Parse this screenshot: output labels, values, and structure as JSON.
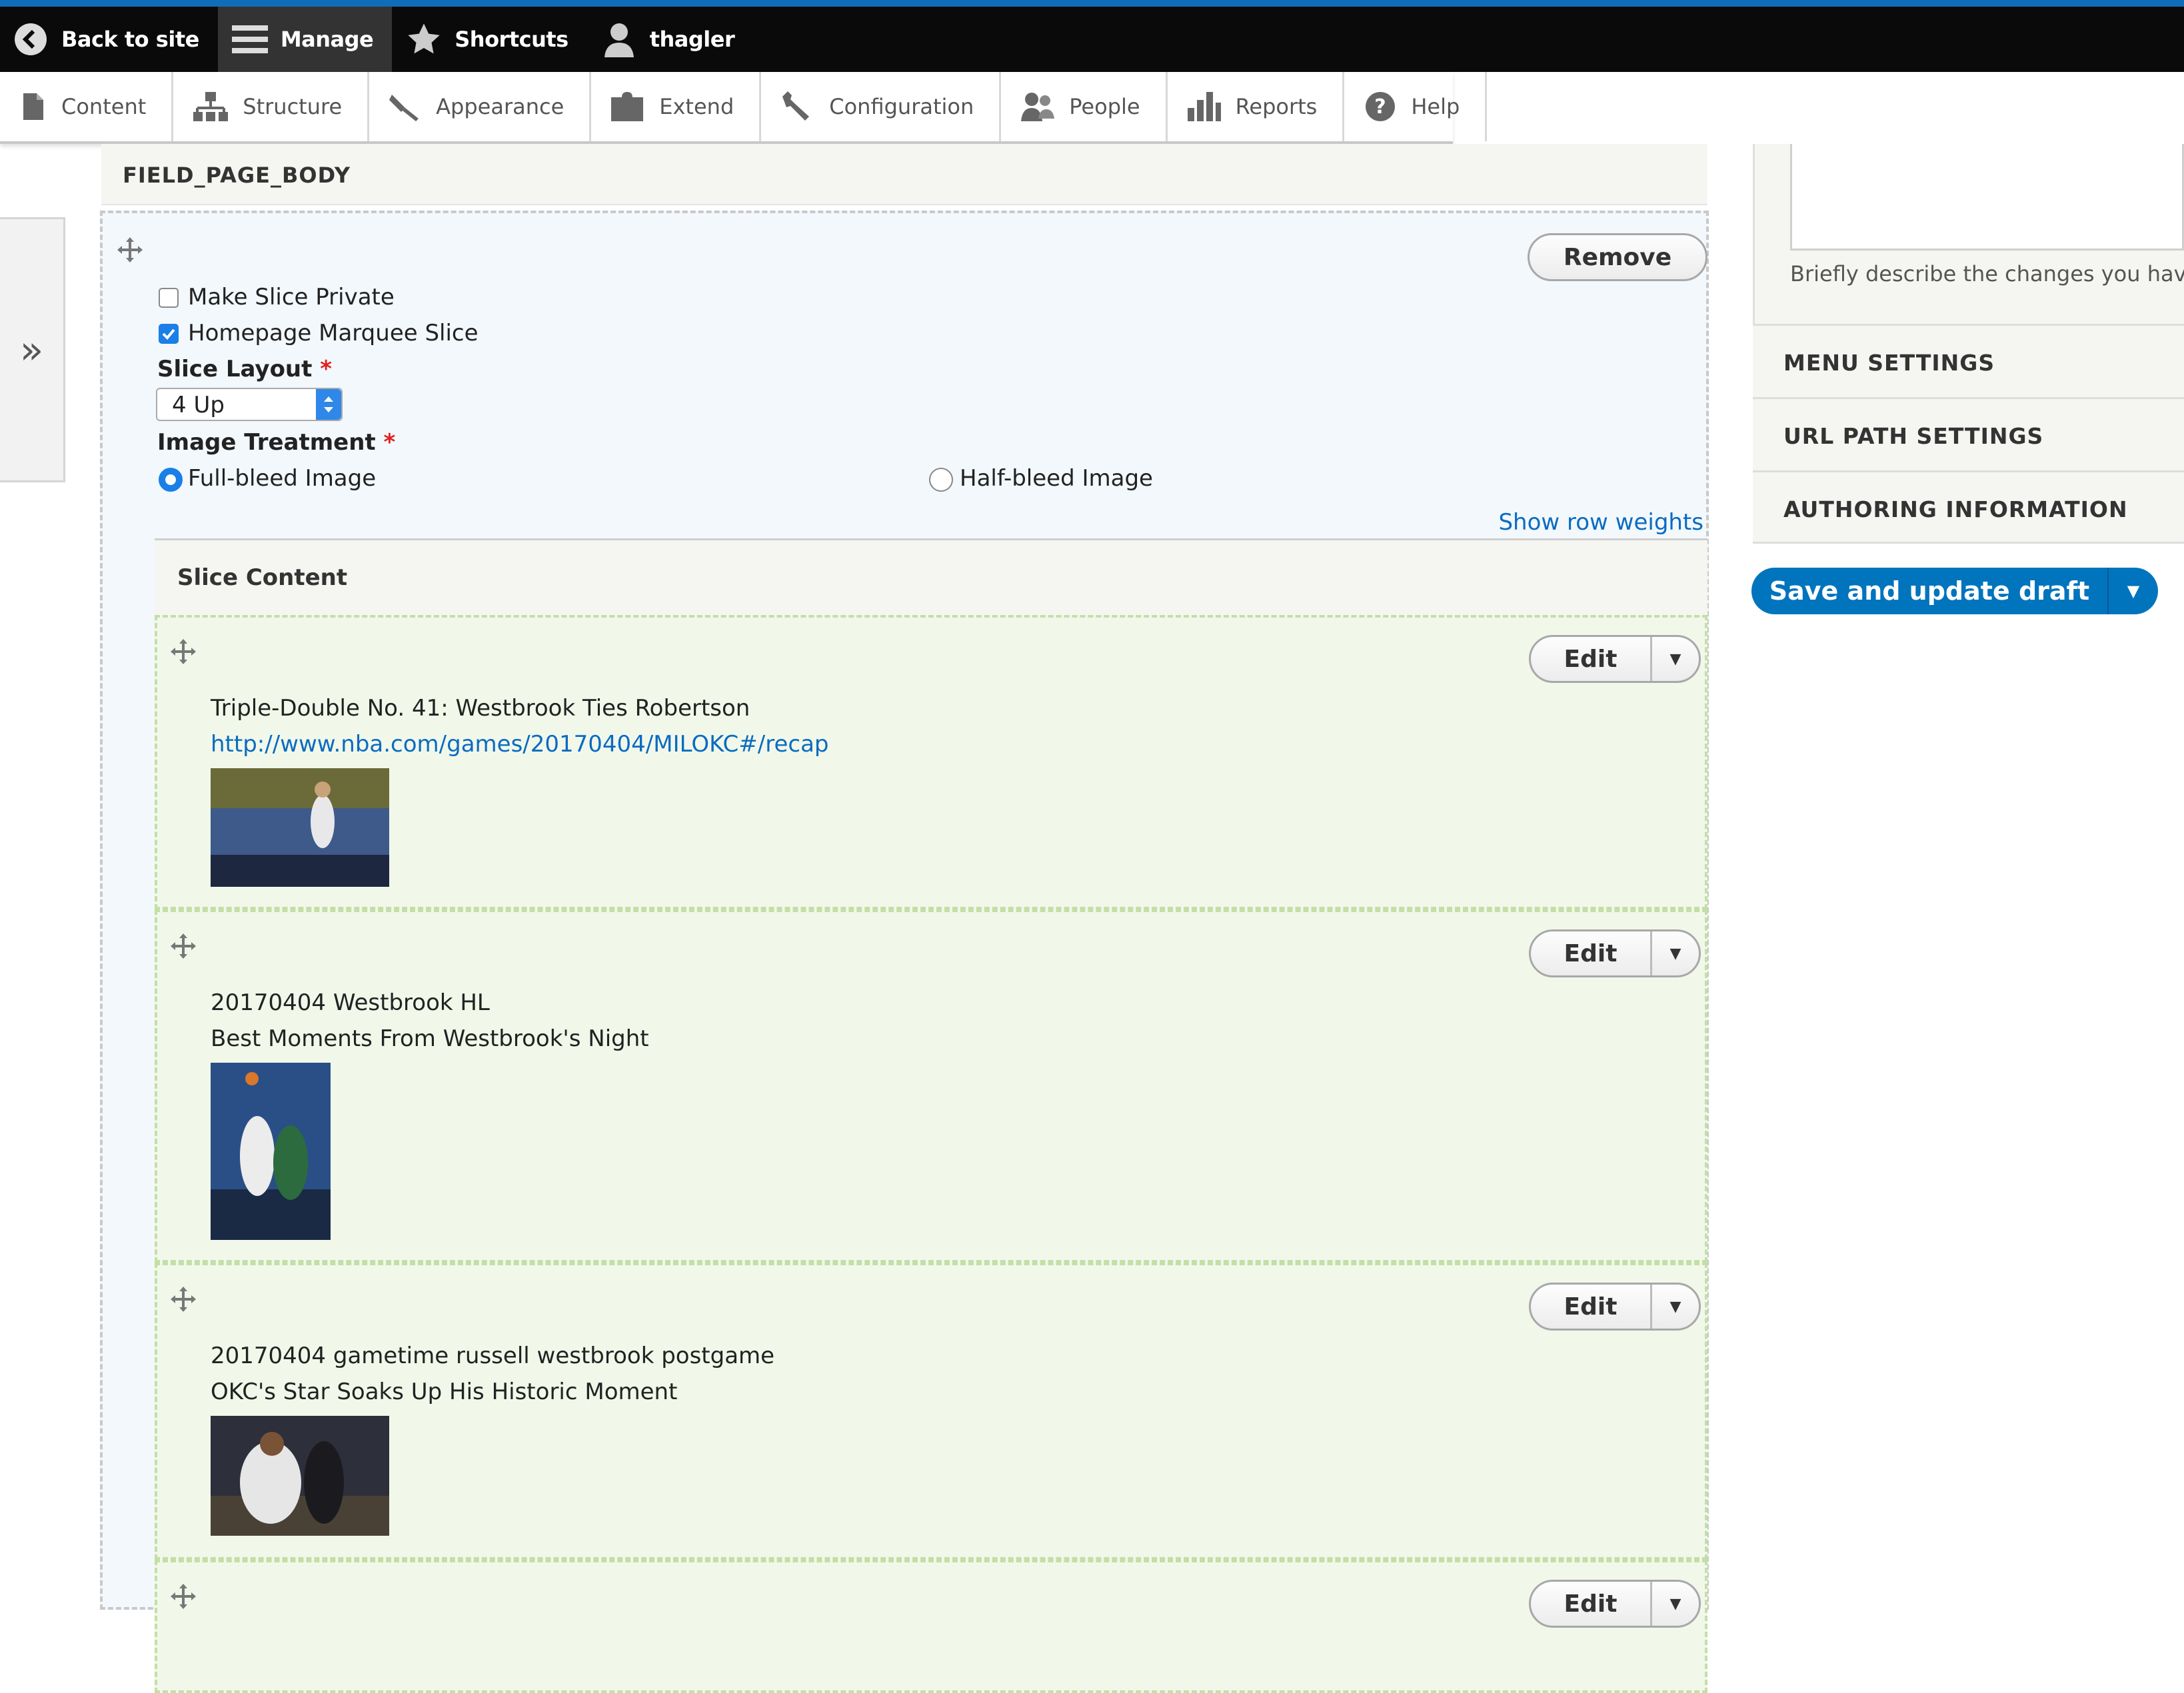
{
  "toolbar": {
    "back": "Back to site",
    "manage": "Manage",
    "shortcuts": "Shortcuts",
    "user": "thagler"
  },
  "tray": {
    "content": "Content",
    "structure": "Structure",
    "appearance": "Appearance",
    "extend": "Extend",
    "configuration": "Configuration",
    "people": "People",
    "reports": "Reports",
    "help": "Help"
  },
  "sidebar_toggle": "»",
  "field": {
    "header": "FIELD_PAGE_BODY",
    "remove_label": "Remove",
    "make_private_label": "Make Slice Private",
    "make_private_checked": false,
    "marquee_label": "Homepage Marquee Slice",
    "marquee_checked": true,
    "layout_label": "Slice Layout",
    "layout_value": "4 Up",
    "treatment_label": "Image Treatment",
    "required_mark": "*",
    "full_bleed_label": "Full-bleed Image",
    "half_bleed_label": "Half-bleed Image",
    "selected_treatment": "Full-bleed Image",
    "show_weights": "Show row weights"
  },
  "slice_content": {
    "header": "Slice Content",
    "edit_label": "Edit",
    "items": [
      {
        "title": "Triple-Double No. 41: Westbrook Ties Robertson",
        "subtitle": "http://www.nba.com/games/20170404/MILOKC#/recap"
      },
      {
        "title": "20170404 Westbrook HL",
        "subtitle": "Best Moments From Westbrook's Night"
      },
      {
        "title": "20170404 gametime russell westbrook postgame",
        "subtitle": "OKC's Star Soaks Up His Historic Moment"
      }
    ]
  },
  "right": {
    "revision_desc": "Briefly describe the changes you have",
    "menu_settings": "MENU SETTINGS",
    "url_settings": "URL PATH SETTINGS",
    "authoring": "AUTHORING INFORMATION",
    "save_label": "Save and update draft"
  },
  "colors": {
    "accent": "#0074bd",
    "toolbar": "#0a0a0a",
    "item_bg": "#f1f8ea"
  }
}
